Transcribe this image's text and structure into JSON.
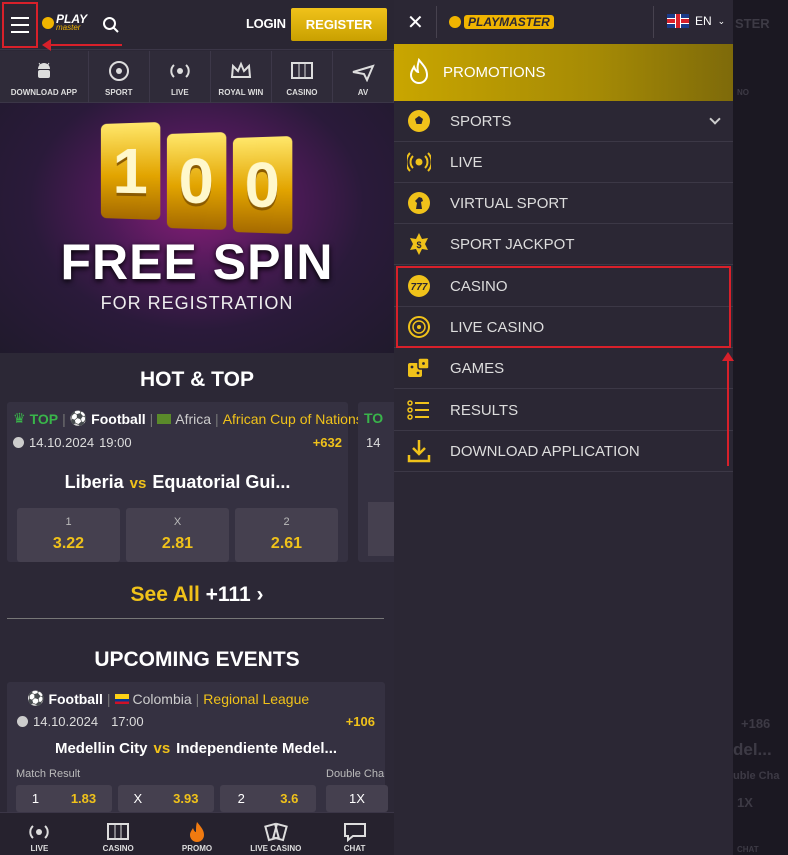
{
  "header": {
    "login": "LOGIN",
    "register": "REGISTER",
    "logo_play": "PLAY",
    "logo_master": "master"
  },
  "categories": [
    {
      "label": "DOWNLOAD APP",
      "icon": "android-icon"
    },
    {
      "label": "SPORT",
      "icon": "soccer-ball-icon"
    },
    {
      "label": "LIVE",
      "icon": "live-broadcast-icon"
    },
    {
      "label": "ROYAL WIN",
      "icon": "crown-icon"
    },
    {
      "label": "CASINO",
      "icon": "slot-machine-icon"
    },
    {
      "label": "AV",
      "icon": "plane-icon"
    }
  ],
  "banner": {
    "number": [
      "1",
      "0",
      "0"
    ],
    "title": "FREE SPIN",
    "subtitle": "FOR REGISTRATION"
  },
  "hot": {
    "title": "HOT & TOP",
    "tag_top": "TOP",
    "sport": "Football",
    "country": "Africa",
    "league": "African Cup of Nations",
    "date": "14.10.2024",
    "time": "19:00",
    "more": "+632",
    "home": "Liberia",
    "vs": "vs",
    "away": "Equatorial Gui...",
    "odds": [
      {
        "label": "1",
        "value": "3.22"
      },
      {
        "label": "X",
        "value": "2.81"
      },
      {
        "label": "2",
        "value": "2.61"
      }
    ],
    "peek_top": "TO",
    "peek_date": "14"
  },
  "see_all": {
    "label": "See All",
    "count": "+111"
  },
  "upcoming": {
    "title": "UPCOMING EVENTS",
    "sport": "Football",
    "country": "Colombia",
    "league": "Regional League",
    "date": "14.10.2024",
    "time": "17:00",
    "more": "+106",
    "home": "Medellin City",
    "vs": "vs",
    "away": "Independiente Medel...",
    "market1": "Match Result",
    "market2": "Double Cha",
    "odds": [
      {
        "label": "1",
        "value": "1.83"
      },
      {
        "label": "X",
        "value": "3.93"
      },
      {
        "label": "2",
        "value": "3.6"
      }
    ],
    "odd_dc": "1X"
  },
  "bottom_nav": [
    {
      "label": "LIVE",
      "icon": "live-broadcast-icon"
    },
    {
      "label": "CASINO",
      "icon": "slot-machine-icon"
    },
    {
      "label": "PROMO",
      "icon": "fire-icon"
    },
    {
      "label": "LIVE CASINO",
      "icon": "cards-icon"
    },
    {
      "label": "CHAT",
      "icon": "chat-icon"
    }
  ],
  "menu": {
    "logo": "PLAYMASTER",
    "lang": "EN",
    "promotions": "PROMOTIONS",
    "items": [
      {
        "label": "SPORTS",
        "icon": "soccer-ball-icon"
      },
      {
        "label": "LIVE",
        "icon": "live-broadcast-icon"
      },
      {
        "label": "VIRTUAL SPORT",
        "icon": "horse-icon"
      },
      {
        "label": "SPORT JACKPOT",
        "icon": "jackpot-star-icon"
      },
      {
        "label": "CASINO",
        "icon": "casino-777-icon"
      },
      {
        "label": "LIVE CASINO",
        "icon": "roulette-icon"
      },
      {
        "label": "GAMES",
        "icon": "dice-icon"
      },
      {
        "label": "RESULTS",
        "icon": "list-icon"
      },
      {
        "label": "DOWNLOAD APPLICATION",
        "icon": "download-icon"
      }
    ]
  },
  "ghost": {
    "register_tail": "STER",
    "casino_tail": "NO",
    "plus": "+186",
    "teams_tail": "del...",
    "dc": "uble Cha",
    "dc_odd": "1X",
    "chat": "CHAT"
  },
  "colors": {
    "accent": "#f0c21a",
    "highlight": "#d8202a",
    "top_green": "#39b54a",
    "bg": "#2c2836"
  }
}
